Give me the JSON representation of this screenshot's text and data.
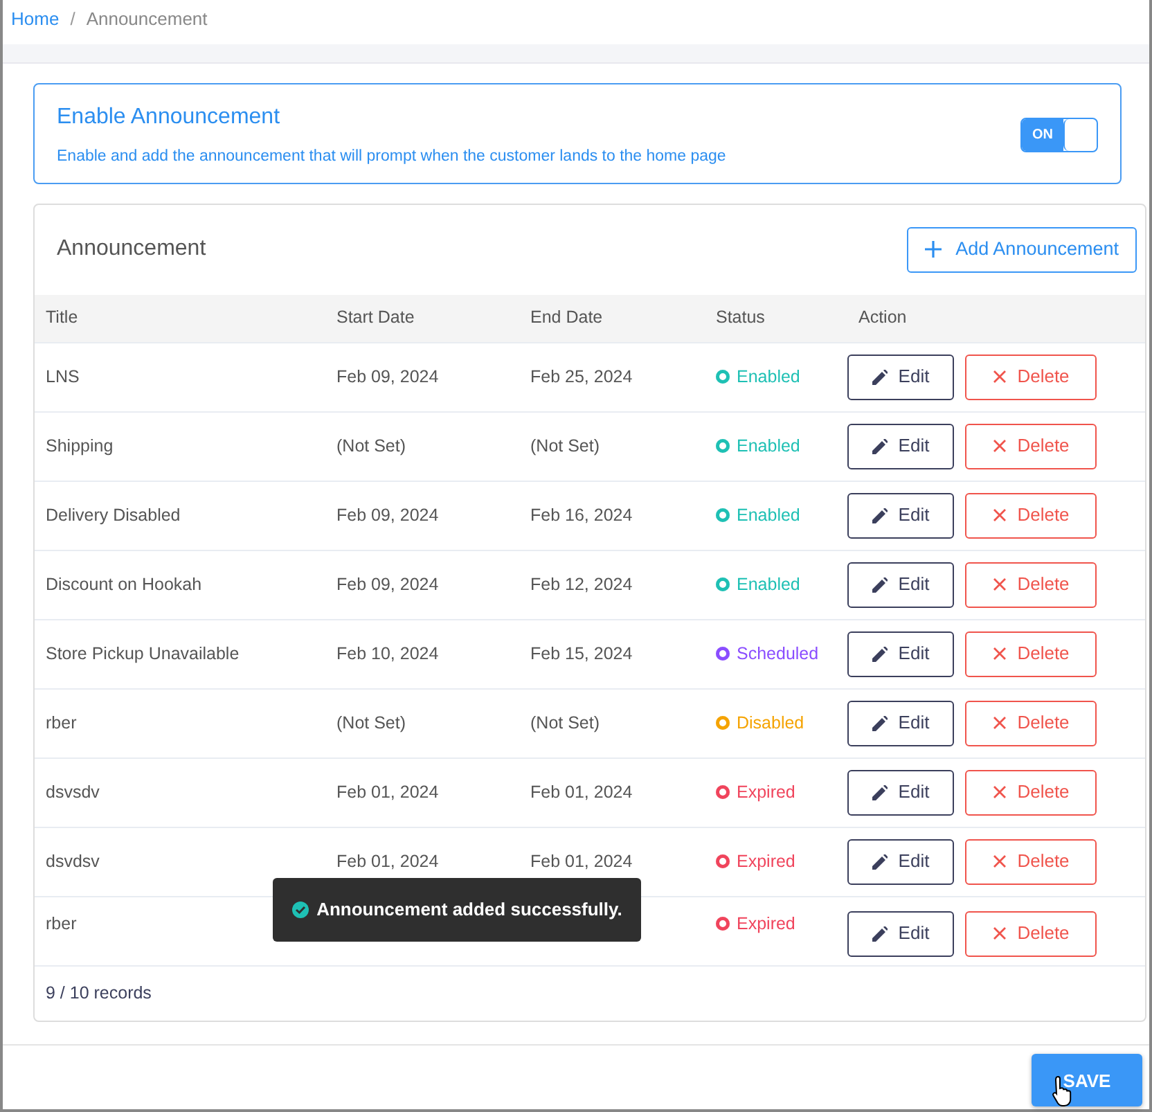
{
  "breadcrumb": [
    {
      "label": "Home",
      "kind": "link"
    },
    {
      "label": "/",
      "kind": "separator"
    },
    {
      "label": "Announcement",
      "kind": "current"
    }
  ],
  "enable": {
    "title": "Enable Announcement",
    "description": "Enable and add the announcement that will prompt when the customer lands to the home page",
    "on": true,
    "toggle_label": "ON"
  },
  "list": {
    "title": "Announcement",
    "add_button": "Add Announcement",
    "columns": [
      "Title",
      "Start Date",
      "End Date",
      "Status",
      "Action"
    ],
    "rows": [
      {
        "title": "LNS",
        "start": "Feb 09, 2024",
        "end": "Feb 25, 2024",
        "status": "Enabled",
        "color": "#1ec0b4",
        "edit": "Edit",
        "delete": "Delete"
      },
      {
        "title": "Shipping",
        "start": "(Not Set)",
        "end": "(Not Set)",
        "status": "Enabled",
        "color": "#1ec0b4",
        "edit": "Edit",
        "delete": "Delete"
      },
      {
        "title": "Delivery Disabled",
        "start": "Feb 09, 2024",
        "end": "Feb 16, 2024",
        "status": "Enabled",
        "color": "#1ec0b4",
        "edit": "Edit",
        "delete": "Delete"
      },
      {
        "title": "Discount on Hookah",
        "start": "Feb 09, 2024",
        "end": "Feb 12, 2024",
        "status": "Enabled",
        "color": "#1ec0b4",
        "edit": "Edit",
        "delete": "Delete"
      },
      {
        "title": "Store Pickup Unavailable",
        "start": "Feb 10, 2024",
        "end": "Feb 15, 2024",
        "status": "Scheduled",
        "color": "#8a4dff",
        "edit": "Edit",
        "delete": "Delete"
      },
      {
        "title": "rber",
        "start": "(Not Set)",
        "end": "(Not Set)",
        "status": "Disabled",
        "color": "#f5a300",
        "edit": "Edit",
        "delete": "Delete"
      },
      {
        "title": "dsvsdv",
        "start": "Feb 01, 2024",
        "end": "Feb 01, 2024",
        "status": "Expired",
        "color": "#f0445c",
        "edit": "Edit",
        "delete": "Delete"
      },
      {
        "title": "dsvdsv",
        "start": "Feb 01, 2024",
        "end": "Feb 01, 2024",
        "status": "Expired",
        "color": "#f0445c",
        "edit": "Edit",
        "delete": "Delete"
      },
      {
        "title": "rber",
        "status": "Expired",
        "color": "#f0445c",
        "edit": "Edit",
        "delete": "Delete"
      }
    ],
    "footer": "9 / 10 records"
  },
  "toast": "Announcement added successfully.",
  "save_button": "SAVE"
}
